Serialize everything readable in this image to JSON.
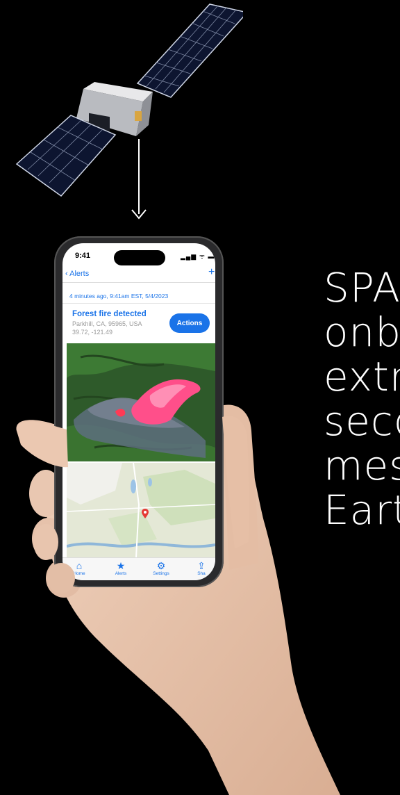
{
  "headline": {
    "lines": [
      "SPA",
      "onb",
      "extr",
      "seco",
      "mes",
      "Eart"
    ]
  },
  "phone": {
    "status": {
      "time": "9:41",
      "icons": "▂▄▆ ᯤ ▬"
    },
    "nav": {
      "back_label": "Alerts",
      "add_label": "+"
    },
    "alert": {
      "timestamp": "4 minutes ago, 9:41am EST,  5/4/2023",
      "title": "Forest fire detected",
      "location": "Parkhill, CA, 95965, USA",
      "coordinates": "39.72, -121.49",
      "actions_label": "Actions"
    },
    "tabs": [
      {
        "label": "Home",
        "icon": "home-icon",
        "glyph": "⌂"
      },
      {
        "label": "Alerts",
        "icon": "star-icon",
        "glyph": "★"
      },
      {
        "label": "Settings",
        "icon": "gear-icon",
        "glyph": "⚙"
      },
      {
        "label": "Sha",
        "icon": "share-icon",
        "glyph": "⇪"
      }
    ]
  },
  "colors": {
    "accent": "#1a73e8",
    "background": "#000000",
    "fire": "#ff4f8a"
  }
}
